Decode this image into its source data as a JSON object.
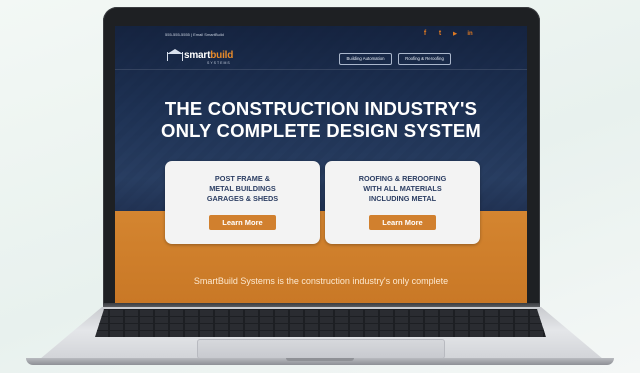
{
  "site": {
    "contact": "555-555-5555 | Email SmartBuild",
    "logo": {
      "brand_a": "smart",
      "brand_b": "build",
      "sub": "SYSTEMS"
    },
    "social": [
      {
        "icon": "facebook-icon",
        "glyph": "f"
      },
      {
        "icon": "twitter-icon",
        "glyph": "t"
      },
      {
        "icon": "youtube-icon",
        "glyph": "▶"
      },
      {
        "icon": "linkedin-icon",
        "glyph": "in"
      }
    ],
    "nav": {
      "building_automation": "Building Automation",
      "roofing": "Roofing & Reroofing"
    },
    "headline_1": "THE CONSTRUCTION INDUSTRY'S",
    "headline_2": "ONLY COMPLETE DESIGN SYSTEM",
    "cards": [
      {
        "line1": "POST FRAME &",
        "line2": "METAL BUILDINGS",
        "line3": "GARAGES & SHEDS",
        "button": "Learn More"
      },
      {
        "line1": "ROOFING & REROOFING",
        "line2": "WITH ALL MATERIALS",
        "line3": "INCLUDING METAL",
        "button": "Learn More"
      }
    ],
    "tagline": "SmartBuild Systems is the construction industry's only complete",
    "colors": {
      "accent": "#d1802e",
      "navy": "#16243e",
      "card_text": "#2c3e63"
    }
  }
}
